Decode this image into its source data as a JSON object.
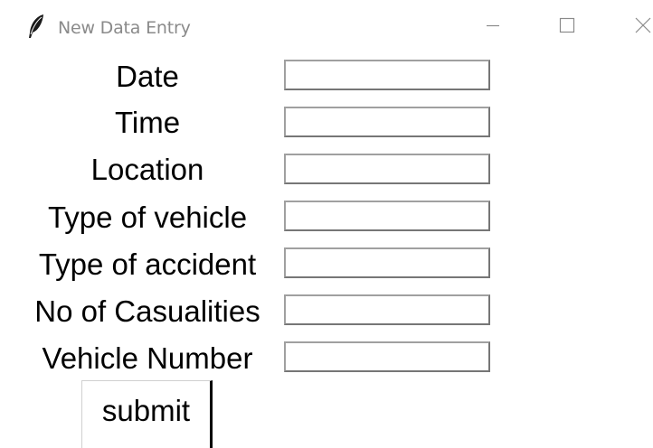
{
  "window": {
    "title": "New Data Entry"
  },
  "form": {
    "fields": [
      {
        "label": "Date",
        "value": ""
      },
      {
        "label": "Time",
        "value": ""
      },
      {
        "label": "Location",
        "value": ""
      },
      {
        "label": "Type of vehicle",
        "value": ""
      },
      {
        "label": "Type of accident",
        "value": ""
      },
      {
        "label": "No of Casualities",
        "value": ""
      },
      {
        "label": "Vehicle Number",
        "value": ""
      }
    ],
    "submit_label": "submit"
  },
  "icons": {
    "app": "feather-icon",
    "minimize": "minimize-icon",
    "maximize": "maximize-icon",
    "close": "close-icon"
  },
  "colors": {
    "background": "#ffffff",
    "title_text": "#8a8a8a",
    "entry_border": "#a0a0a0",
    "label_text": "#000000"
  }
}
